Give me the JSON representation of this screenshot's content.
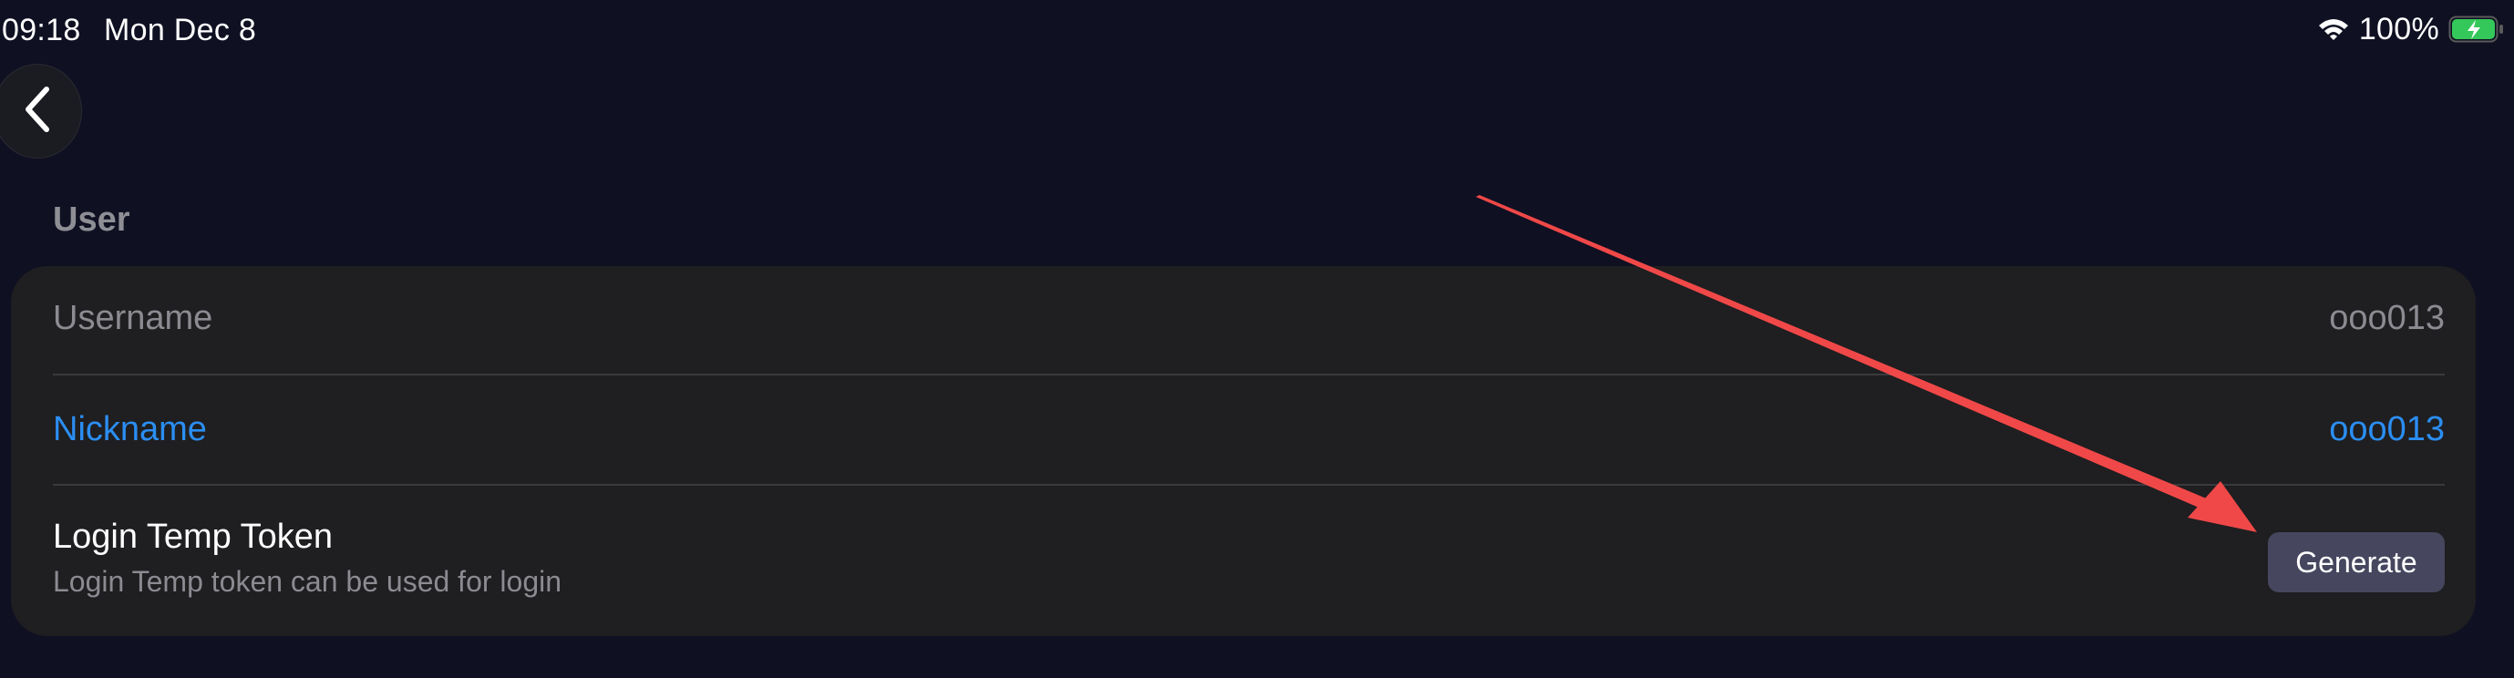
{
  "status_bar": {
    "time": "09:18",
    "date": "Mon Dec 8",
    "battery_percent": "100%",
    "battery_level": 1.0,
    "charging": true
  },
  "nav": {
    "back_icon": "chevron-left-icon"
  },
  "section": {
    "title": "User"
  },
  "rows": {
    "username": {
      "label": "Username",
      "value": "ooo013"
    },
    "nickname": {
      "label": "Nickname",
      "value": "ooo013"
    },
    "token": {
      "title": "Login Temp Token",
      "subtitle": "Login Temp token can be used for login",
      "button_label": "Generate"
    }
  },
  "colors": {
    "background": "#0f1022",
    "card": "#1f1e20",
    "accent_link": "#2b8ef2",
    "muted_text": "#8b8b92",
    "button_bg": "#46465f",
    "annotation_arrow": "#f04848"
  }
}
